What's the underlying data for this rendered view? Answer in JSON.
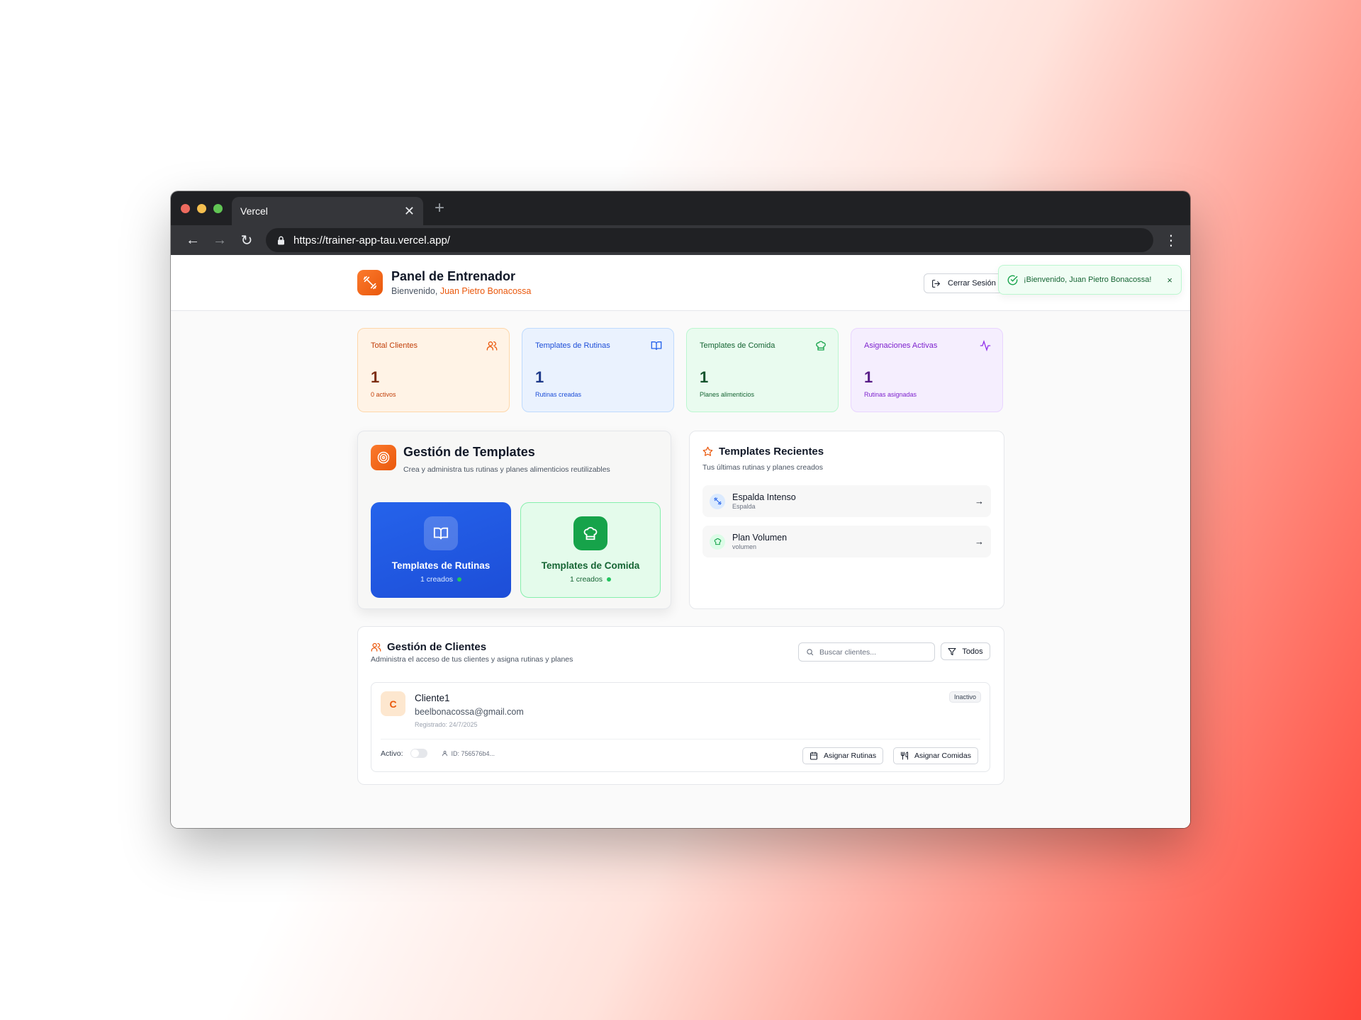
{
  "browser": {
    "tab_title": "Vercel",
    "tab_close": "✕",
    "new_tab": "+",
    "url": "https://trainer-app-tau.vercel.app/"
  },
  "header": {
    "title": "Panel de Entrenador",
    "welcome_prefix": "Bienvenido, ",
    "user_name": "Juan Pietro Bonacossa",
    "logout_label": "Cerrar Sesión"
  },
  "toast": {
    "message": "¡Bienvenido, Juan Pietro Bonacossa!",
    "close": "×"
  },
  "stats": [
    {
      "label": "Total Clientes",
      "value": "1",
      "sub": "0 activos",
      "icon": "users-icon"
    },
    {
      "label": "Templates de Rutinas",
      "value": "1",
      "sub": "Rutinas creadas",
      "icon": "book-icon"
    },
    {
      "label": "Templates de Comida",
      "value": "1",
      "sub": "Planes alimenticios",
      "icon": "chef-hat-icon"
    },
    {
      "label": "Asignaciones Activas",
      "value": "1",
      "sub": "Rutinas asignadas",
      "icon": "activity-icon"
    }
  ],
  "templates": {
    "title": "Gestión de Templates",
    "subtitle": "Crea y administra tus rutinas y planes alimenticios reutilizables",
    "routines_tile": {
      "title": "Templates de Rutinas",
      "sub": "1 creados"
    },
    "meals_tile": {
      "title": "Templates de Comida",
      "sub": "1 creados"
    }
  },
  "recent": {
    "title": "Templates Recientes",
    "subtitle": "Tus últimas rutinas y planes creados",
    "items": [
      {
        "name": "Espalda Intenso",
        "category": "Espalda",
        "icon": "dumbbell-icon"
      },
      {
        "name": "Plan Volumen",
        "category": "volumen",
        "icon": "chef-hat-icon"
      }
    ]
  },
  "clients": {
    "title": "Gestión de Clientes",
    "subtitle": "Administra el acceso de tus clientes y asigna rutinas y planes",
    "search_placeholder": "Buscar clientes...",
    "filter_label": "Todos",
    "list": [
      {
        "initial": "C",
        "name": "Cliente1",
        "email": "beelbonacossa@gmail.com",
        "registered": "Registrado: 24/7/2025",
        "status": "Inactivo",
        "active_label": "Activo:",
        "active": false,
        "id": "ID: 756576b4...",
        "assign_routines": "Asignar Rutinas",
        "assign_meals": "Asignar Comidas"
      }
    ]
  },
  "colors": {
    "accent_orange": "#ea580c",
    "blue": "#2563eb",
    "green": "#16a34a",
    "purple": "#7e22ce"
  }
}
